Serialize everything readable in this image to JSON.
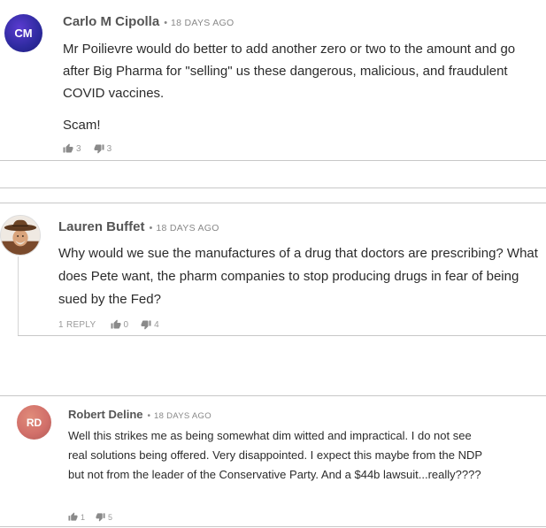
{
  "comments": [
    {
      "initials": "CM",
      "avatar_color": "#2d2a9e",
      "author": "Carlo M Cipolla",
      "separator": "•",
      "time": "18 DAYS AGO",
      "paragraphs": [
        "Mr Poilievre would do better to add another zero or two to the amount and go after Big Pharma for \"selling\" us these dangerous, malicious, and fraudulent COVID vaccines.",
        "Scam!"
      ],
      "likes": "3",
      "dislikes": "3"
    },
    {
      "avatar_image": "cowboy-hat-portrait",
      "author": "Lauren Buffet",
      "separator": "•",
      "time": "18 DAYS AGO",
      "paragraphs": [
        "Why would we sue the manufactures of a drug that doctors are prescribing? What does Pete want, the pharm companies to stop producing drugs in fear of being sued by the Fed?"
      ],
      "reply_label": "1 REPLY",
      "likes": "0",
      "dislikes": "4"
    },
    {
      "initials": "RD",
      "avatar_color": "#d2706a",
      "author": "Robert Deline",
      "separator": "•",
      "time": "18 DAYS AGO",
      "paragraphs": [
        "Well this strikes me as being somewhat dim witted and impractical. I do not see real solutions being offered. Very disappointed. I expect this maybe from the NDP but not from the leader of the Conservative Party. And a $44b lawsuit...really????"
      ],
      "likes": "1",
      "dislikes": "5"
    }
  ]
}
